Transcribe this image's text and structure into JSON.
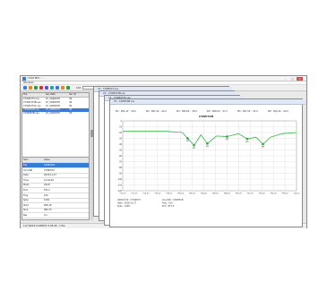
{
  "app": {
    "title": "CirKit MTV - ...",
    "menu": [
      "Windows"
    ],
    "controls": {
      "minimize": "–",
      "maximize": "□",
      "close": "×"
    }
  },
  "toolbar": {
    "icons": [
      "open-icon",
      "save-icon",
      "print-icon",
      "cut-icon",
      "copy-icon",
      "paste-icon",
      "undo-icon",
      "redo-icon",
      "zoom-icon",
      "search-icon",
      "settings-icon",
      "refresh-icon",
      "chart-icon",
      "grid-icon",
      "export-icon",
      "help-icon"
    ],
    "field1_label": "Cmt:",
    "field2_label": "Cmt2:",
    "icon_colors": [
      "#3b78d8",
      "#e08a28",
      "#2e9e44",
      "#c83a3a",
      "#6b4fc6",
      "#2aa0b8"
    ]
  },
  "file_list": {
    "headers": [
      "File",
      "Ser Path",
      "Ser ID"
    ],
    "rows": [
      {
        "file": "C7WPUT3.csv",
        "path": "LF_2046678",
        "id": "30"
      },
      {
        "file": "C7WPUT3B.csv",
        "path": "LF_2046678",
        "id": "30"
      },
      {
        "file": "C7WPUT3C.csv",
        "path": "LF_2046678",
        "id": "30"
      },
      {
        "file": "C3WP3CB.csv",
        "path": "LF_2046678",
        "id": "30"
      },
      {
        "file": "C3WP3TB.csv",
        "path": "LF_2046678",
        "id": "30"
      }
    ],
    "selected_index": 3
  },
  "properties": {
    "headers": [
      "Item",
      "Value"
    ],
    "rows": [
      {
        "k": "File",
        "v": "C3WP3CB"
      },
      {
        "k": "CircuitID",
        "v": "C7WPUT3"
      },
      {
        "k": "Date",
        "v": "2018-11-27"
      },
      {
        "k": "Time",
        "v": "12:04:00"
      },
      {
        "k": "Mode",
        "v": "LOAD"
      },
      {
        "k": "Port",
        "v": "PT1.2"
      },
      {
        "k": "Freq",
        "v": "100"
      },
      {
        "k": "Span",
        "v": "1000"
      },
      {
        "k": "Start",
        "v": "908.18"
      },
      {
        "k": "Stop",
        "v": "999.70"
      },
      {
        "k": "Res",
        "v": "0.1"
      }
    ]
  },
  "windows": [
    {
      "title": "C3 - C7WPUT3.csv"
    },
    {
      "title": "C3 - C7WPUT3B.csv"
    },
    {
      "title": "C3 - C7WPUT3C.csv"
    },
    {
      "title": "C3 - C3WP3CB.csv"
    }
  ],
  "chart_data": {
    "type": "line",
    "title": "C3WP3CB",
    "xlabel": "",
    "ylabel": "",
    "x": [
      970.0,
      972.0,
      974.0,
      976.0,
      978.0,
      980.0,
      982.0,
      984.0,
      986.0,
      988.0,
      990.0,
      992.0,
      994.0,
      996.0,
      998.0,
      1000.0
    ],
    "ylim": [
      -120,
      0
    ],
    "y_ticks": [
      0,
      -10,
      -20,
      -30,
      -40,
      -50,
      -60,
      -70,
      -80,
      -90,
      -100,
      -110,
      -120
    ],
    "x_ticks": [
      "970.00",
      "972.00",
      "974.00",
      "976.00",
      "978.00",
      "980.00",
      "982.00",
      "984.00",
      "986.00",
      "988.00",
      "990.00",
      "992.00",
      "994.00",
      "996.00",
      "998.00",
      "1000.0"
    ],
    "series": [
      {
        "values": [
          -18,
          -18,
          -18,
          -18,
          -18,
          -18,
          -19,
          -20,
          -30,
          -42,
          -24,
          -39,
          -26,
          -27,
          -22,
          -31,
          -28,
          -40,
          -28,
          -22,
          -20
        ]
      }
    ],
    "series_x": [
      970,
      971.5,
      973,
      974.5,
      976,
      977.5,
      979,
      980.3,
      981.2,
      982.3,
      983.5,
      984.6,
      986.2,
      988.0,
      990.0,
      991.5,
      993.0,
      994.2,
      995.5,
      997.5,
      1000
    ],
    "markers": [
      {
        "x": 981.2,
        "y": -30,
        "label": "M1"
      },
      {
        "x": 982.3,
        "y": -42,
        "label": "M2"
      },
      {
        "x": 984.6,
        "y": -39,
        "label": "M3"
      },
      {
        "x": 988.0,
        "y": -27,
        "label": "M4"
      },
      {
        "x": 991.5,
        "y": -31,
        "label": "M5"
      },
      {
        "x": 994.2,
        "y": -40,
        "label": "M6"
      }
    ],
    "header_readouts": [
      "M1 : 981.20 : -30.0",
      "M2 : 982.30 : -42.0",
      "M3 : 984.60 : -39.0",
      "M4 : 988.00 : -27.0",
      "M5 : 991.50 : -31.0",
      "M6 : 994.20 : -40.0"
    ],
    "footer_lines": [
      "CIRCUIT ID : C7WPUT3",
      "Date : 2018-11-27",
      "Span : 1000",
      "CircuitID : C3WP3CB",
      "Freq : 100",
      "Port : PT1.2"
    ],
    "line_color": "#3cb34a",
    "grid": true
  },
  "status_bar": {
    "text": "11/7/2018 CirKitMTV 3.06.46 - 1 file"
  }
}
